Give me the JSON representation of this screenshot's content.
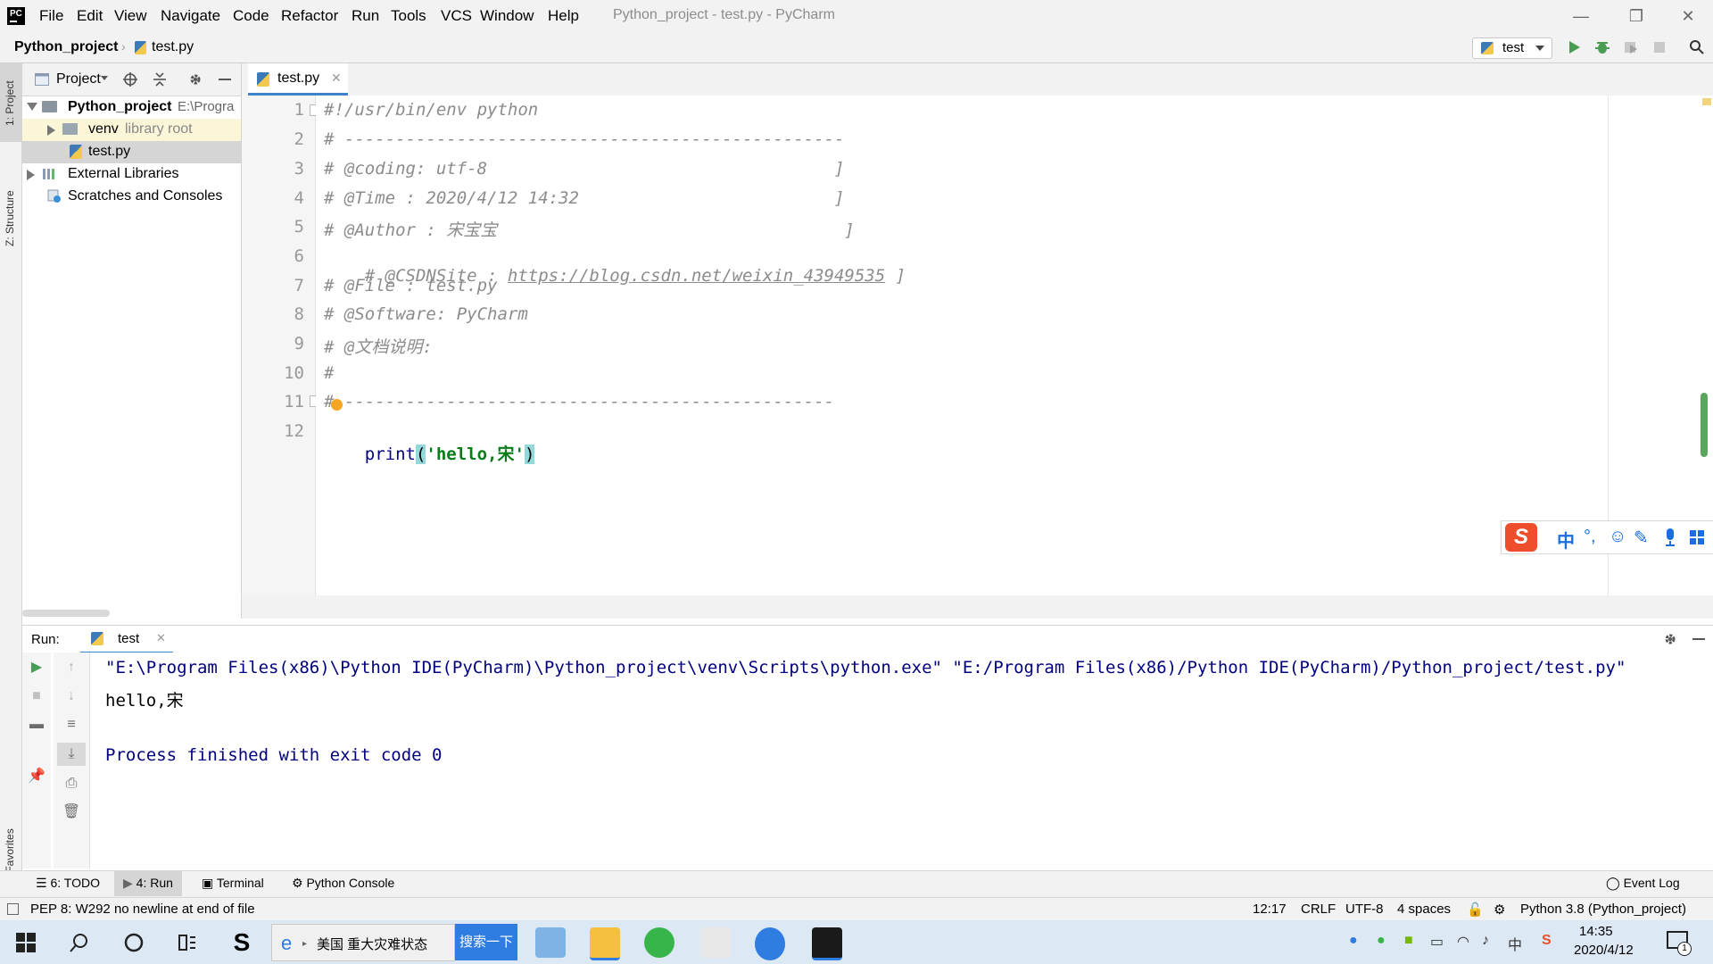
{
  "app": {
    "logo_text": "PC",
    "window_title": "Python_project - test.py - PyCharm"
  },
  "menu": [
    {
      "label": "File",
      "key": "F"
    },
    {
      "label": "Edit",
      "key": "E"
    },
    {
      "label": "View",
      "key": "V"
    },
    {
      "label": "Navigate",
      "key": "N"
    },
    {
      "label": "Code",
      "key": "C"
    },
    {
      "label": "Refactor",
      "key": "R"
    },
    {
      "label": "Run",
      "key": "u"
    },
    {
      "label": "Tools",
      "key": "T"
    },
    {
      "label": "VCS",
      "key": "S"
    },
    {
      "label": "Window",
      "key": "W"
    },
    {
      "label": "Help",
      "key": "H"
    }
  ],
  "window_controls": {
    "minimize": "—",
    "restore": "❐",
    "close": "✕"
  },
  "breadcrumb": {
    "project": "Python_project",
    "file": "test.py"
  },
  "run_config": {
    "label": "test"
  },
  "left_strip": {
    "project_tab": "1: Project",
    "structure_tab": "Z: Structure",
    "favorites_tab": "2: Favorites"
  },
  "project_panel": {
    "title": "Project",
    "tree": [
      {
        "label": "Python_project",
        "suffix": "E:\\Progra",
        "bold": true
      },
      {
        "label": "venv",
        "suffix": "library root"
      },
      {
        "label": "test.py",
        "selected": true
      },
      {
        "label": "External Libraries"
      },
      {
        "label": "Scratches and Consoles"
      }
    ]
  },
  "editor": {
    "tab_label": "test.py",
    "lines": [
      {
        "n": "1",
        "text": "#!/usr/bin/env python"
      },
      {
        "n": "2",
        "text": "# -------------------------------------------------"
      },
      {
        "n": "3",
        "text": "# @coding: utf-8                                  ]"
      },
      {
        "n": "4",
        "text": "# @Time : 2020/4/12 14:32                         ]"
      },
      {
        "n": "5",
        "text": "# @Author : 宋宝宝                                  ]"
      },
      {
        "n": "6",
        "prefix": "# @CSDNSite : ",
        "link": "https://blog.csdn.net/weixin_43949535",
        "suffix": " ]"
      },
      {
        "n": "7",
        "text": "# @File : test.py"
      },
      {
        "n": "8",
        "text": "# @Software: PyCharm"
      },
      {
        "n": "9",
        "text": "# @文档说明:"
      },
      {
        "n": "10",
        "text": "#"
      },
      {
        "n": "11",
        "text": "#-------------------------------------------------"
      },
      {
        "n": "12",
        "kw": "print",
        "open": "(",
        "str": "'hello,宋'",
        "close": ")"
      }
    ]
  },
  "run_panel": {
    "label": "Run:",
    "tab": "test",
    "output": [
      "\"E:\\Program Files(x86)\\Python IDE(PyCharm)\\Python_project\\venv\\Scripts\\python.exe\" \"E:/Program Files(x86)/Python IDE(PyCharm)/Python_project/test.py\"",
      "hello,宋",
      "",
      "Process finished with exit code 0"
    ]
  },
  "bottom_tabs": {
    "todo": "6: TODO",
    "run": "4: Run",
    "terminal": "Terminal",
    "python_console": "Python Console",
    "event_log": "Event Log"
  },
  "status": {
    "message": "PEP 8: W292 no newline at end of file",
    "position": "12:17",
    "line_sep": "CRLF",
    "encoding": "UTF-8",
    "indent": "4 spaces",
    "interpreter": "Python 3.8 (Python_project)"
  },
  "ime": {
    "logo": "S",
    "lang": "中"
  },
  "taskbar": {
    "news_text": "美国 重大灾难状态",
    "search_btn": "搜索一下",
    "tray_lang": "中",
    "time": "14:35",
    "date": "2020/4/12",
    "notif_count": "1"
  },
  "colors": {
    "accent": "#4083c9",
    "comment": "#8c8c8c",
    "keyword": "#000080",
    "string": "#067d17",
    "current_line": "#fcfaed"
  }
}
